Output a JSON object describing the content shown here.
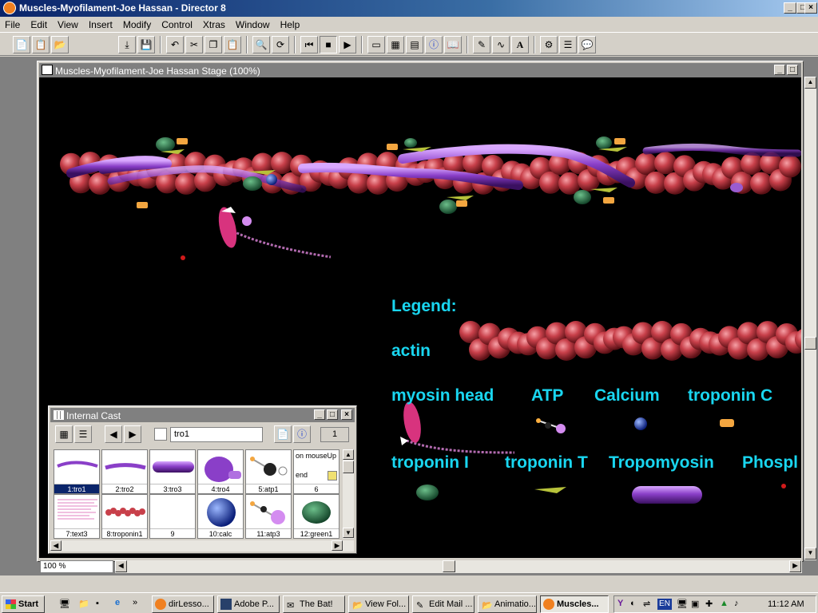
{
  "window": {
    "title": "Muscles-Myofilament-Joe Hassan - Director 8"
  },
  "menu": [
    "File",
    "Edit",
    "View",
    "Insert",
    "Modify",
    "Control",
    "Xtras",
    "Window",
    "Help"
  ],
  "stage": {
    "title": "Muscles-Myofilament-Joe Hassan Stage (100%)",
    "zoom": "100 %"
  },
  "legend": {
    "heading": "Legend:",
    "actin": "actin",
    "myosin_head": "myosin head",
    "atp": "ATP",
    "calcium": "Calcium",
    "troponin_c": "troponin C",
    "troponin_i": "troponin I",
    "troponin_t": "troponin T",
    "tropomyosin": "Tropomyosin",
    "phosph": "Phospl"
  },
  "cast": {
    "title": "Internal Cast",
    "member_name": "tro1",
    "member_number": "1",
    "members": [
      {
        "label": "1:tro1"
      },
      {
        "label": "2:tro2"
      },
      {
        "label": "3:tro3"
      },
      {
        "label": "4:tro4"
      },
      {
        "label": "5:atp1"
      },
      {
        "label": "6",
        "script_line1": "on mouseUp",
        "script_line2": "end"
      },
      {
        "label": "7:text3"
      },
      {
        "label": "8:troponin1"
      },
      {
        "label": "9"
      },
      {
        "label": "10:calc"
      },
      {
        "label": "11:atp3"
      },
      {
        "label": "12:green1"
      }
    ]
  },
  "taskbar": {
    "start": "Start",
    "tasks": [
      "dirLesso...",
      "Adobe P...",
      "The Bat!",
      "View Fol...",
      "Edit Mail ...",
      "Animatio...",
      "Muscles..."
    ],
    "lang": "EN",
    "clock": "11:12 AM"
  },
  "colors": {
    "legend_text": "#19d6f0",
    "actin": "#c8404a",
    "tropomyosin": "#8a3fc8",
    "title_bar": "#0a246a"
  }
}
